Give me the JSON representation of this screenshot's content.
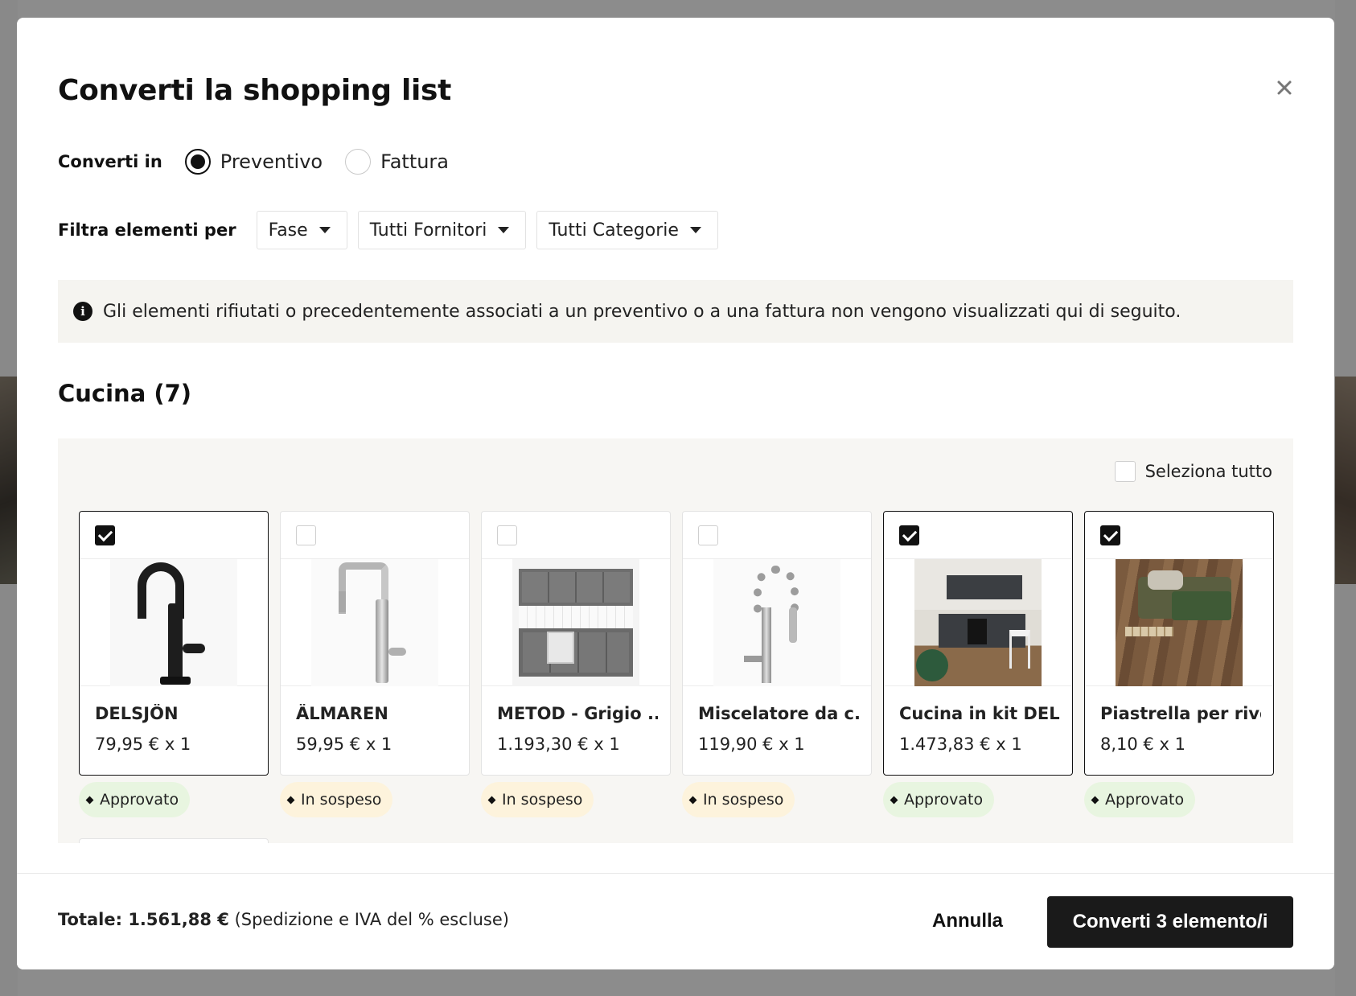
{
  "modal": {
    "title": "Converti la shopping list",
    "close_label": "×"
  },
  "convert": {
    "label": "Converti in",
    "options": [
      {
        "label": "Preventivo",
        "selected": true
      },
      {
        "label": "Fattura",
        "selected": false
      }
    ]
  },
  "filter": {
    "label": "Filtra elementi per",
    "dropdowns": [
      "Fase",
      "Tutti Fornitori",
      "Tutti Categorie"
    ]
  },
  "info": {
    "icon": "info-icon",
    "text": "Gli elementi rifiutati o precedentemente associati a un preventivo o a una fattura non vengono visualizzati qui di seguito."
  },
  "section": {
    "title": "Cucina (7)",
    "select_all_label": "Seleziona tutto",
    "items": [
      {
        "name": "DELSJÖN",
        "price": "79,95 € x 1",
        "status": "Approvato",
        "checked": true
      },
      {
        "name": "ÄLMAREN",
        "price": "59,95 € x 1",
        "status": "In sospeso",
        "checked": false
      },
      {
        "name": "METOD - Grigio ...",
        "price": "1.193,30 € x 1",
        "status": "In sospeso",
        "checked": false
      },
      {
        "name": "Miscelatore da c...",
        "price": "119,90 € x 1",
        "status": "In sospeso",
        "checked": false
      },
      {
        "name": "Cucina in kit DEL...",
        "price": "1.473,83 € x 1",
        "status": "Approvato",
        "checked": true
      },
      {
        "name": "Piastrella per rive...",
        "price": "8,10 € x 1",
        "status": "Approvato",
        "checked": true
      }
    ]
  },
  "footer": {
    "total_label": "Totale: 1.561,88 €",
    "total_note": "(Spedizione e IVA del % escluse)",
    "cancel_label": "Annulla",
    "convert_label": "Converti 3 elemento/i"
  },
  "colors": {
    "primary_button": "#1a1a1a",
    "approved_badge": "#e8f5e0",
    "pending_badge": "#fdf3dc",
    "info_bg": "#f5f4f0"
  }
}
